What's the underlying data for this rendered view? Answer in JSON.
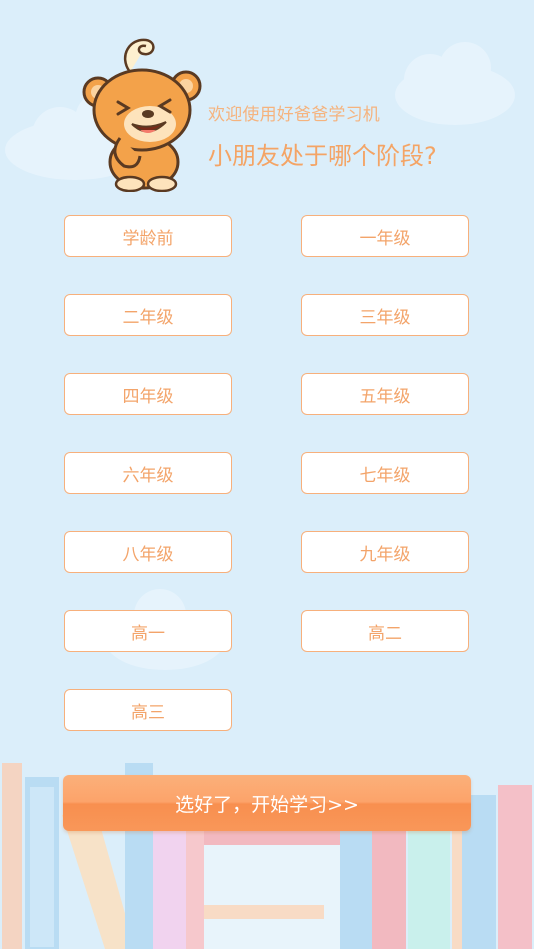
{
  "header": {
    "welcome": "欢迎使用好爸爸学习机",
    "question": "小朋友处于哪个阶段?"
  },
  "grades": [
    "学龄前",
    "一年级",
    "二年级",
    "三年级",
    "四年级",
    "五年级",
    "六年级",
    "七年级",
    "八年级",
    "九年级",
    "高一",
    "高二",
    "高三"
  ],
  "start_button": {
    "label": "选好了，开始学习>>"
  },
  "colors": {
    "background": "#dbeefa",
    "accent": "#f4a465",
    "button_border": "#f7b07c",
    "start_button": "#fca36a"
  },
  "icons": {
    "mascot": "bear-mascot-icon"
  }
}
